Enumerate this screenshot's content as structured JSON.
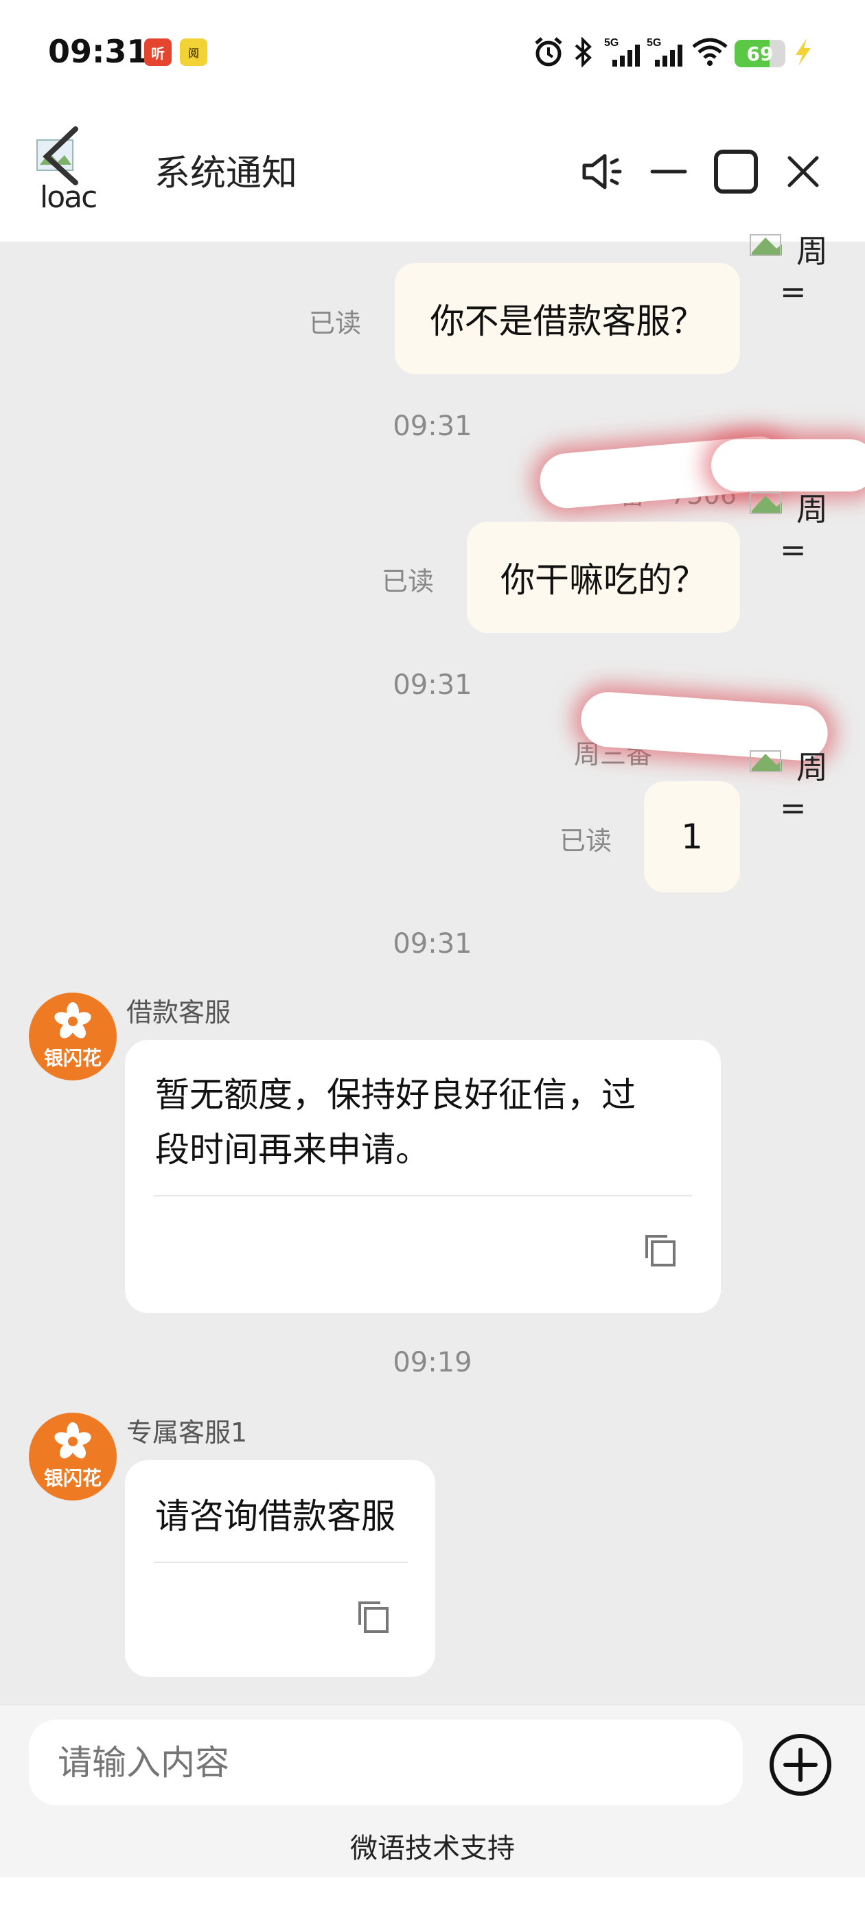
{
  "status_bar": {
    "time": "09:31",
    "app_badges": [
      "听",
      "阅"
    ],
    "network_labels": [
      "5G",
      "5G"
    ],
    "battery_percent": "69",
    "battery_level": 0.69
  },
  "header": {
    "title": "系统通知",
    "back_alt_text": "loac"
  },
  "messages": {
    "out1": {
      "text": "你不是借款客服？",
      "read": "已读",
      "side_name": "周",
      "side_eq": "="
    },
    "ts1": "09:31",
    "out2": {
      "text": "你干嘛吃的？",
      "read": "已读",
      "sender_partial": "周三番 · 7506",
      "side_name": "周",
      "side_eq": "="
    },
    "ts2": "09:31",
    "out3": {
      "text": "1",
      "read": "已读",
      "sender_partial": "周三番",
      "side_name": "周",
      "side_eq": "="
    },
    "ts3": "09:31",
    "in1": {
      "sender": "借款客服",
      "text_line1": "暂无额度，保持好良好征信，过",
      "text_line2": "段时间再来申请。",
      "avatar_label": "银闪花"
    },
    "ts4": "09:19",
    "in2": {
      "sender": "专属客服1",
      "text": "请咨询借款客服",
      "avatar_label": "银闪花"
    }
  },
  "input": {
    "placeholder": "请输入内容"
  },
  "footer": {
    "support": "微语技术支持"
  },
  "colors": {
    "avatar": "#ee7a24",
    "outgoing_bubble": "#fef9ee",
    "chat_bg": "#ececec"
  }
}
